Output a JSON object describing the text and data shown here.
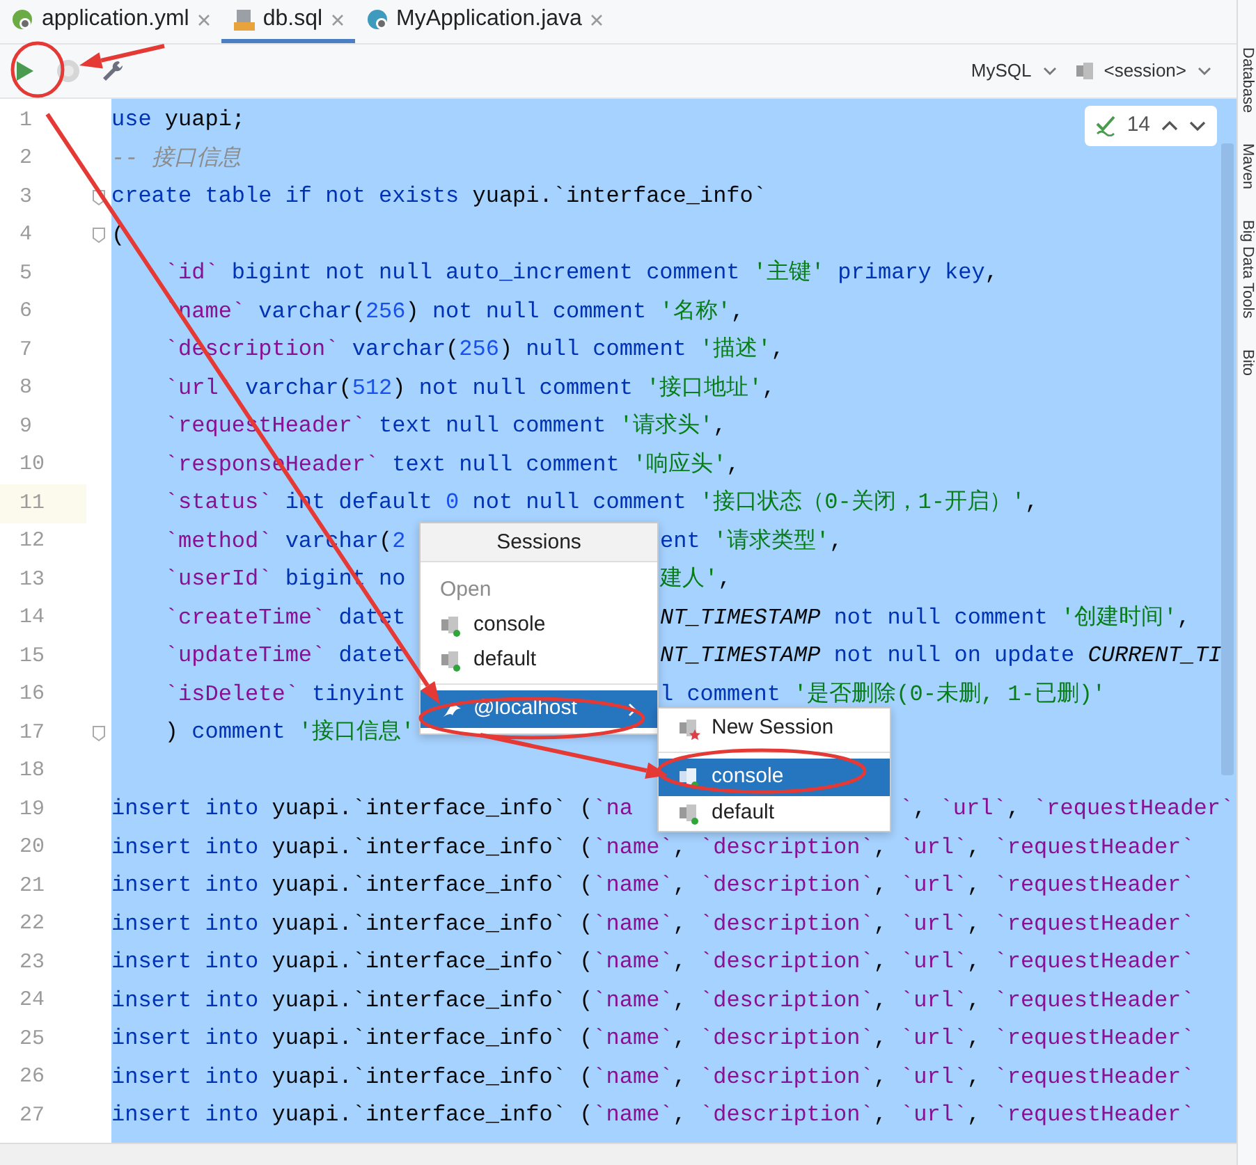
{
  "tabs": [
    {
      "label": "application.yml",
      "kind": "yaml",
      "selected": false
    },
    {
      "label": "db.sql",
      "kind": "sql",
      "selected": true
    },
    {
      "label": "MyApplication.java",
      "kind": "java",
      "selected": false
    }
  ],
  "toolbar": {
    "dialect": "MySQL",
    "session": "<session>"
  },
  "inspection": {
    "count": "14"
  },
  "lines": [
    {
      "num": "1",
      "current": false,
      "fold": false,
      "segments": [
        {
          "kind": "lead",
          "tokens": [
            {
              "kind": "keyword",
              "text": "use"
            },
            {
              "kind": "plain",
              "text": " yuapi;"
            }
          ]
        }
      ]
    },
    {
      "num": "2",
      "current": false,
      "fold": false,
      "segments": [
        {
          "kind": "lead",
          "tokens": [
            {
              "kind": "comment",
              "text": "-- 接口信息"
            }
          ]
        }
      ]
    },
    {
      "num": "3",
      "current": false,
      "fold": true,
      "segments": [
        {
          "kind": "lead",
          "tokens": [
            {
              "kind": "keyword",
              "text": "create table if not exists"
            },
            {
              "kind": "plain",
              "text": " yuapi.`interface_info`"
            }
          ]
        }
      ]
    },
    {
      "num": "4",
      "current": false,
      "fold": true,
      "segments": [
        {
          "kind": "lead",
          "tokens": [
            {
              "kind": "plain",
              "text": "("
            }
          ]
        }
      ]
    },
    {
      "num": "5",
      "current": false,
      "fold": false,
      "segments": [
        {
          "kind": "lead",
          "tokens": [
            {
              "kind": "field",
              "text": "    `id`"
            },
            {
              "kind": "keyword",
              "text": " bigint not null auto_increment comment "
            },
            {
              "kind": "string",
              "text": "'主键'"
            },
            {
              "kind": "keyword",
              "text": " primary key"
            },
            {
              "kind": "plain",
              "text": ","
            }
          ]
        }
      ]
    },
    {
      "num": "6",
      "current": false,
      "fold": false,
      "segments": [
        {
          "kind": "lead",
          "tokens": [
            {
              "kind": "field",
              "text": "    `name`"
            },
            {
              "kind": "keyword",
              "text": " varchar"
            },
            {
              "kind": "plain",
              "text": "("
            },
            {
              "kind": "number",
              "text": "256"
            },
            {
              "kind": "plain",
              "text": ") "
            },
            {
              "kind": "keyword",
              "text": "not null comment "
            },
            {
              "kind": "string",
              "text": "'名称'"
            },
            {
              "kind": "plain",
              "text": ","
            }
          ]
        }
      ]
    },
    {
      "num": "7",
      "current": false,
      "fold": false,
      "segments": [
        {
          "kind": "lead",
          "tokens": [
            {
              "kind": "field",
              "text": "    `description`"
            },
            {
              "kind": "keyword",
              "text": " varchar"
            },
            {
              "kind": "plain",
              "text": "("
            },
            {
              "kind": "number",
              "text": "256"
            },
            {
              "kind": "plain",
              "text": ") "
            },
            {
              "kind": "keyword",
              "text": "null comment "
            },
            {
              "kind": "string",
              "text": "'描述'"
            },
            {
              "kind": "plain",
              "text": ","
            }
          ]
        }
      ]
    },
    {
      "num": "8",
      "current": false,
      "fold": false,
      "segments": [
        {
          "kind": "lead",
          "tokens": [
            {
              "kind": "field",
              "text": "    `url`"
            },
            {
              "kind": "keyword",
              "text": " varchar"
            },
            {
              "kind": "plain",
              "text": "("
            },
            {
              "kind": "number",
              "text": "512"
            },
            {
              "kind": "plain",
              "text": ") "
            },
            {
              "kind": "keyword",
              "text": "not null comment "
            },
            {
              "kind": "string",
              "text": "'接口地址'"
            },
            {
              "kind": "plain",
              "text": ","
            }
          ]
        }
      ]
    },
    {
      "num": "9",
      "current": false,
      "fold": false,
      "segments": [
        {
          "kind": "lead",
          "tokens": [
            {
              "kind": "field",
              "text": "    `requestHeader`"
            },
            {
              "kind": "keyword",
              "text": " text null comment "
            },
            {
              "kind": "string",
              "text": "'请求头'"
            },
            {
              "kind": "plain",
              "text": ","
            }
          ]
        }
      ]
    },
    {
      "num": "10",
      "current": false,
      "fold": false,
      "segments": [
        {
          "kind": "lead",
          "tokens": [
            {
              "kind": "field",
              "text": "    `responseHeader`"
            },
            {
              "kind": "keyword",
              "text": " text null comment "
            },
            {
              "kind": "string",
              "text": "'响应头'"
            },
            {
              "kind": "plain",
              "text": ","
            }
          ]
        }
      ]
    },
    {
      "num": "11",
      "current": true,
      "fold": false,
      "segments": [
        {
          "kind": "lead",
          "tokens": [
            {
              "kind": "field",
              "text": "    `status`"
            },
            {
              "kind": "keyword",
              "text": " int default "
            },
            {
              "kind": "number",
              "text": "0"
            },
            {
              "kind": "keyword",
              "text": " not null comment "
            },
            {
              "kind": "string",
              "text": "'接口状态（0-关闭，1-开启）'"
            },
            {
              "kind": "plain",
              "text": ","
            }
          ]
        }
      ]
    },
    {
      "num": "12",
      "current": false,
      "fold": false,
      "segments": [
        {
          "kind": "lead",
          "tokens": [
            {
              "kind": "field",
              "text": "    `method`"
            },
            {
              "kind": "keyword",
              "text": " varchar"
            },
            {
              "kind": "plain",
              "text": "("
            },
            {
              "kind": "number",
              "text": "2"
            }
          ]
        },
        {
          "kind": "mid",
          "tokens": [
            {
              "kind": "keyword",
              "text": "ent "
            },
            {
              "kind": "string",
              "text": "'请求类型'"
            },
            {
              "kind": "plain",
              "text": ","
            }
          ]
        }
      ]
    },
    {
      "num": "13",
      "current": false,
      "fold": false,
      "segments": [
        {
          "kind": "lead",
          "tokens": [
            {
              "kind": "field",
              "text": "    `userId`"
            },
            {
              "kind": "keyword",
              "text": " bigint no"
            }
          ]
        },
        {
          "kind": "mid",
          "tokens": [
            {
              "kind": "string",
              "text": "建人'"
            },
            {
              "kind": "plain",
              "text": ","
            }
          ]
        }
      ]
    },
    {
      "num": "14",
      "current": false,
      "fold": false,
      "segments": [
        {
          "kind": "lead",
          "tokens": [
            {
              "kind": "field",
              "text": "    `createTime`"
            },
            {
              "kind": "keyword",
              "text": " datet"
            }
          ]
        },
        {
          "kind": "mid",
          "tokens": [
            {
              "kind": "italic",
              "text": "NT_TIMESTAMP"
            },
            {
              "kind": "keyword",
              "text": " not null comment "
            },
            {
              "kind": "string",
              "text": "'创建时间'"
            },
            {
              "kind": "plain",
              "text": ","
            }
          ]
        }
      ]
    },
    {
      "num": "15",
      "current": false,
      "fold": false,
      "segments": [
        {
          "kind": "lead",
          "tokens": [
            {
              "kind": "field",
              "text": "    `updateTime`"
            },
            {
              "kind": "keyword",
              "text": " datet"
            }
          ]
        },
        {
          "kind": "mid",
          "tokens": [
            {
              "kind": "italic",
              "text": "NT_TIMESTAMP"
            },
            {
              "kind": "keyword",
              "text": " not null on update "
            },
            {
              "kind": "italic",
              "text": "CURRENT_TI"
            }
          ]
        }
      ]
    },
    {
      "num": "16",
      "current": false,
      "fold": false,
      "segments": [
        {
          "kind": "lead",
          "tokens": [
            {
              "kind": "field",
              "text": "    `isDelete`"
            },
            {
              "kind": "keyword",
              "text": " tinyint"
            }
          ]
        },
        {
          "kind": "mid",
          "tokens": [
            {
              "kind": "keyword",
              "text": "l comment "
            },
            {
              "kind": "string",
              "text": "'是否删除(0-未删, 1-已删)'"
            }
          ]
        }
      ]
    },
    {
      "num": "17",
      "current": false,
      "fold": true,
      "segments": [
        {
          "kind": "lead",
          "tokens": [
            {
              "kind": "plain",
              "text": "    ) "
            },
            {
              "kind": "keyword",
              "text": "comment "
            },
            {
              "kind": "string",
              "text": "'接口信息'"
            }
          ]
        }
      ]
    },
    {
      "num": "18",
      "current": false,
      "fold": false
    },
    {
      "num": "19",
      "current": false,
      "fold": false,
      "segments": [
        {
          "kind": "lead",
          "tokens": [
            {
              "kind": "keyword",
              "text": "insert into"
            },
            {
              "kind": "plain",
              "text": " yuapi.`interface_info` ("
            },
            {
              "kind": "field",
              "text": "`na"
            }
          ]
        },
        {
          "kind": "far",
          "tokens": [
            {
              "kind": "field",
              "text": "`"
            },
            {
              "kind": "plain",
              "text": ", "
            },
            {
              "kind": "field",
              "text": "`url`"
            },
            {
              "kind": "plain",
              "text": ", "
            },
            {
              "kind": "field",
              "text": "`requestHeader`"
            }
          ]
        }
      ]
    },
    {
      "num": "20",
      "current": false,
      "fold": false,
      "segments": [
        {
          "kind": "lead",
          "tokens": [
            {
              "kind": "keyword",
              "text": "insert into"
            },
            {
              "kind": "plain",
              "text": " yuapi.`interface_info` ("
            },
            {
              "kind": "field",
              "text": "`name`"
            },
            {
              "kind": "plain",
              "text": ", "
            },
            {
              "kind": "field",
              "text": "`description`"
            },
            {
              "kind": "plain",
              "text": ", "
            },
            {
              "kind": "field",
              "text": "`url`"
            },
            {
              "kind": "plain",
              "text": ", "
            },
            {
              "kind": "field",
              "text": "`requestHeader`"
            }
          ]
        }
      ]
    },
    {
      "num": "21",
      "current": false,
      "fold": false,
      "segments": [
        {
          "kind": "lead",
          "tokens": [
            {
              "kind": "keyword",
              "text": "insert into"
            },
            {
              "kind": "plain",
              "text": " yuapi.`interface_info` ("
            },
            {
              "kind": "field",
              "text": "`name`"
            },
            {
              "kind": "plain",
              "text": ", "
            },
            {
              "kind": "field",
              "text": "`description`"
            },
            {
              "kind": "plain",
              "text": ", "
            },
            {
              "kind": "field",
              "text": "`url`"
            },
            {
              "kind": "plain",
              "text": ", "
            },
            {
              "kind": "field",
              "text": "`requestHeader`"
            }
          ]
        }
      ]
    },
    {
      "num": "22",
      "current": false,
      "fold": false,
      "segments": [
        {
          "kind": "lead",
          "tokens": [
            {
              "kind": "keyword",
              "text": "insert into"
            },
            {
              "kind": "plain",
              "text": " yuapi.`interface_info` ("
            },
            {
              "kind": "field",
              "text": "`name`"
            },
            {
              "kind": "plain",
              "text": ", "
            },
            {
              "kind": "field",
              "text": "`description`"
            },
            {
              "kind": "plain",
              "text": ", "
            },
            {
              "kind": "field",
              "text": "`url`"
            },
            {
              "kind": "plain",
              "text": ", "
            },
            {
              "kind": "field",
              "text": "`requestHeader`"
            }
          ]
        }
      ]
    },
    {
      "num": "23",
      "current": false,
      "fold": false,
      "segments": [
        {
          "kind": "lead",
          "tokens": [
            {
              "kind": "keyword",
              "text": "insert into"
            },
            {
              "kind": "plain",
              "text": " yuapi.`interface_info` ("
            },
            {
              "kind": "field",
              "text": "`name`"
            },
            {
              "kind": "plain",
              "text": ", "
            },
            {
              "kind": "field",
              "text": "`description`"
            },
            {
              "kind": "plain",
              "text": ", "
            },
            {
              "kind": "field",
              "text": "`url`"
            },
            {
              "kind": "plain",
              "text": ", "
            },
            {
              "kind": "field",
              "text": "`requestHeader`"
            }
          ]
        }
      ]
    },
    {
      "num": "24",
      "current": false,
      "fold": false,
      "segments": [
        {
          "kind": "lead",
          "tokens": [
            {
              "kind": "keyword",
              "text": "insert into"
            },
            {
              "kind": "plain",
              "text": " yuapi.`interface_info` ("
            },
            {
              "kind": "field",
              "text": "`name`"
            },
            {
              "kind": "plain",
              "text": ", "
            },
            {
              "kind": "field",
              "text": "`description`"
            },
            {
              "kind": "plain",
              "text": ", "
            },
            {
              "kind": "field",
              "text": "`url`"
            },
            {
              "kind": "plain",
              "text": ", "
            },
            {
              "kind": "field",
              "text": "`requestHeader`"
            }
          ]
        }
      ]
    },
    {
      "num": "25",
      "current": false,
      "fold": false,
      "segments": [
        {
          "kind": "lead",
          "tokens": [
            {
              "kind": "keyword",
              "text": "insert into"
            },
            {
              "kind": "plain",
              "text": " yuapi.`interface_info` ("
            },
            {
              "kind": "field",
              "text": "`name`"
            },
            {
              "kind": "plain",
              "text": ", "
            },
            {
              "kind": "field",
              "text": "`description`"
            },
            {
              "kind": "plain",
              "text": ", "
            },
            {
              "kind": "field",
              "text": "`url`"
            },
            {
              "kind": "plain",
              "text": ", "
            },
            {
              "kind": "field",
              "text": "`requestHeader`"
            }
          ]
        }
      ]
    },
    {
      "num": "26",
      "current": false,
      "fold": false,
      "segments": [
        {
          "kind": "lead",
          "tokens": [
            {
              "kind": "keyword",
              "text": "insert into"
            },
            {
              "kind": "plain",
              "text": " yuapi.`interface_info` ("
            },
            {
              "kind": "field",
              "text": "`name`"
            },
            {
              "kind": "plain",
              "text": ", "
            },
            {
              "kind": "field",
              "text": "`description`"
            },
            {
              "kind": "plain",
              "text": ", "
            },
            {
              "kind": "field",
              "text": "`url`"
            },
            {
              "kind": "plain",
              "text": ", "
            },
            {
              "kind": "field",
              "text": "`requestHeader`"
            }
          ]
        }
      ]
    },
    {
      "num": "27",
      "current": false,
      "fold": false,
      "segments": [
        {
          "kind": "lead",
          "tokens": [
            {
              "kind": "keyword",
              "text": "insert into"
            },
            {
              "kind": "plain",
              "text": " yuapi.`interface_info` ("
            },
            {
              "kind": "field",
              "text": "`name`"
            },
            {
              "kind": "plain",
              "text": ", "
            },
            {
              "kind": "field",
              "text": "`description`"
            },
            {
              "kind": "plain",
              "text": ", "
            },
            {
              "kind": "field",
              "text": "`url`"
            },
            {
              "kind": "plain",
              "text": ", "
            },
            {
              "kind": "field",
              "text": "`requestHeader`"
            }
          ]
        }
      ]
    }
  ],
  "sessions_popup": {
    "title": "Sessions",
    "section": "Open",
    "items": [
      {
        "label": "console",
        "kind": "session",
        "selected": false
      },
      {
        "label": "default",
        "kind": "session",
        "selected": false
      },
      {
        "label": "@localhost",
        "kind": "host",
        "selected": true
      }
    ]
  },
  "submenu": {
    "items": [
      {
        "label": "New Session",
        "kind": "new",
        "selected": false
      },
      {
        "label": "console",
        "kind": "session",
        "selected": true
      },
      {
        "label": "default",
        "kind": "session",
        "selected": false
      }
    ]
  },
  "side_tools": [
    "Database",
    "Maven",
    "Big Data Tools",
    "Bito"
  ]
}
